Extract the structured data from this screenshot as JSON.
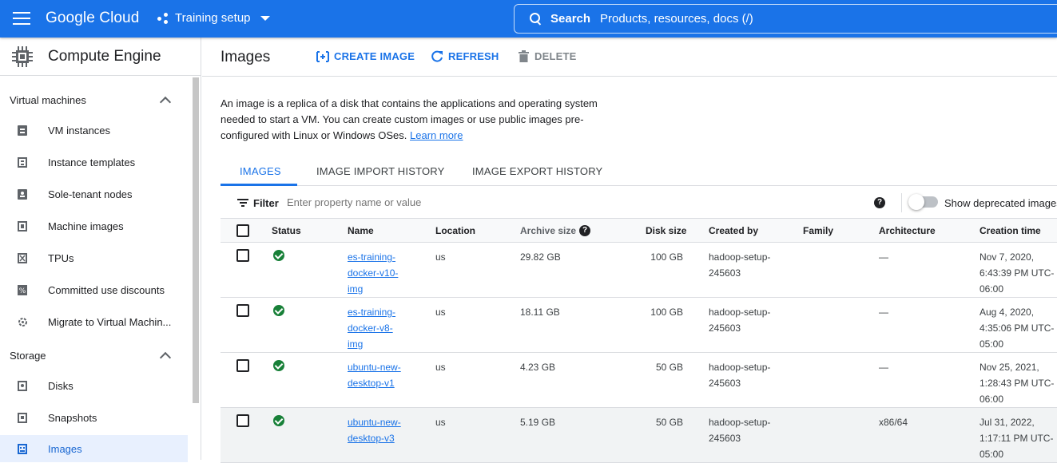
{
  "header": {
    "logo": "Google Cloud",
    "project": "Training setup",
    "search_label": "Search",
    "search_placeholder": "Products, resources, docs (/)"
  },
  "sidebar": {
    "title": "Compute Engine",
    "sections": [
      {
        "label": "Virtual machines",
        "items": [
          {
            "label": "VM instances",
            "icon": "vm-icon"
          },
          {
            "label": "Instance templates",
            "icon": "template-icon"
          },
          {
            "label": "Sole-tenant nodes",
            "icon": "sole-tenant-icon"
          },
          {
            "label": "Machine images",
            "icon": "machine-image-icon"
          },
          {
            "label": "TPUs",
            "icon": "tpu-icon"
          },
          {
            "label": "Committed use discounts",
            "icon": "percent-icon"
          },
          {
            "label": "Migrate to Virtual Machin...",
            "icon": "migrate-icon"
          }
        ]
      },
      {
        "label": "Storage",
        "items": [
          {
            "label": "Disks",
            "icon": "disk-icon"
          },
          {
            "label": "Snapshots",
            "icon": "snapshot-icon"
          },
          {
            "label": "Images",
            "icon": "images-icon",
            "active": true
          }
        ]
      }
    ]
  },
  "toolbar": {
    "title": "Images",
    "create_label": "CREATE IMAGE",
    "refresh_label": "REFRESH",
    "delete_label": "DELETE"
  },
  "description": {
    "text": "An image is a replica of a disk that contains the applications and operating system needed to start a VM. You can create custom images or use public images pre-configured with Linux or Windows OSes.",
    "link": "Learn more"
  },
  "tabs": [
    "IMAGES",
    "IMAGE IMPORT HISTORY",
    "IMAGE EXPORT HISTORY"
  ],
  "filter": {
    "label": "Filter",
    "placeholder": "Enter property name or value",
    "toggle_label": "Show deprecated images"
  },
  "table": {
    "columns": [
      "Status",
      "Name",
      "Location",
      "Archive size",
      "Disk size",
      "Created by",
      "Family",
      "Architecture",
      "Creation time"
    ],
    "rows": [
      {
        "name": [
          "es-training-",
          "docker-v10-",
          "img"
        ],
        "location": "us",
        "archive_size": "29.82 GB",
        "disk_size": "100 GB",
        "created_by": [
          "hadoop-setup-",
          "245603"
        ],
        "family": "",
        "architecture": "—",
        "creation_time": [
          "Nov 7, 2020,",
          "6:43:39 PM UTC-",
          "06:00"
        ]
      },
      {
        "name": [
          "es-training-",
          "docker-v8-",
          "img"
        ],
        "location": "us",
        "archive_size": "18.11 GB",
        "disk_size": "100 GB",
        "created_by": [
          "hadoop-setup-",
          "245603"
        ],
        "family": "",
        "architecture": "—",
        "creation_time": [
          "Aug 4, 2020,",
          "4:35:06 PM UTC-",
          "05:00"
        ]
      },
      {
        "name": [
          "ubuntu-new-",
          "desktop-v1"
        ],
        "location": "us",
        "archive_size": "4.23 GB",
        "disk_size": "50 GB",
        "created_by": [
          "hadoop-setup-",
          "245603"
        ],
        "family": "",
        "architecture": "—",
        "creation_time": [
          "Nov 25, 2021,",
          "1:28:43 PM UTC-",
          "06:00"
        ]
      },
      {
        "name": [
          "ubuntu-new-",
          "desktop-v3"
        ],
        "location": "us",
        "archive_size": "5.19 GB",
        "disk_size": "50 GB",
        "created_by": [
          "hadoop-setup-",
          "245603"
        ],
        "family": "",
        "architecture": "x86/64",
        "creation_time": [
          "Jul 31, 2022,",
          "1:17:11 PM UTC-",
          "05:00"
        ]
      }
    ]
  },
  "colors": {
    "brand": "#1a73e8",
    "success": "#188038"
  }
}
